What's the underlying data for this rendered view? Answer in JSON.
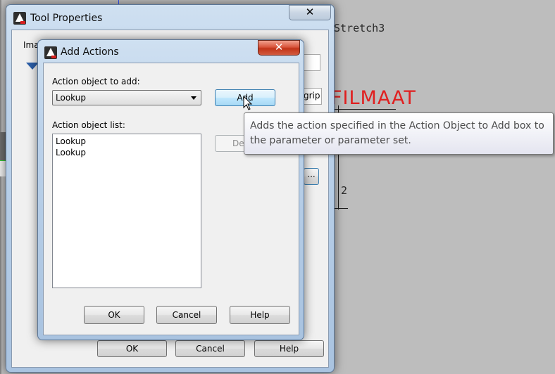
{
  "cad": {
    "stretch_label": "Stretch3",
    "filmaat_label": "FILMAAT",
    "dim_label": "2"
  },
  "tool_properties": {
    "title": "Tool Properties",
    "close_glyph": "✕",
    "partial_image_label": "Ima",
    "partial_text": "grip",
    "ok_label": "OK",
    "cancel_label": "Cancel",
    "help_label": "Help",
    "ellipsis_label": "..."
  },
  "add_actions": {
    "title": "Add Actions",
    "close_glyph": "✕",
    "action_object_label": "Action object to add:",
    "action_object_value": "Lookup",
    "add_label": "Add",
    "delete_partial_label": "De",
    "list_label": "Action object list:",
    "list_items": [
      "Lookup",
      "Lookup"
    ],
    "ok_label": "OK",
    "cancel_label": "Cancel",
    "help_label": "Help"
  },
  "tooltip": {
    "text": "Adds the action specified in the Action Object to Add box to the parameter or parameter set."
  },
  "colors": {
    "close_hot": "#c13418",
    "cad_red": "#e02020",
    "tooltip_text": "#4c4c4c"
  }
}
